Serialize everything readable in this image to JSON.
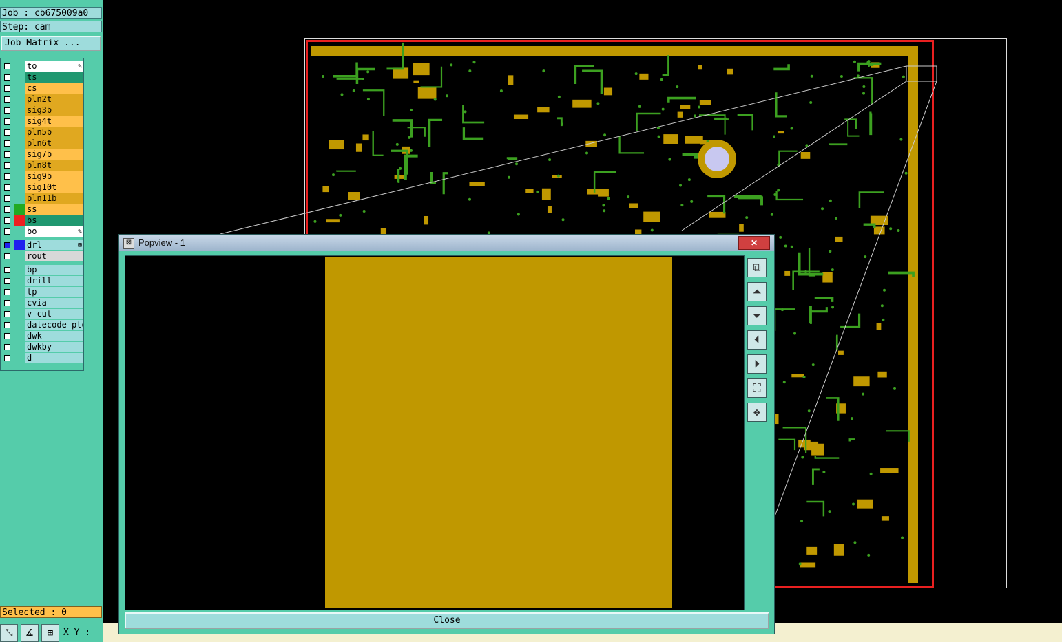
{
  "job_label": "Job : cb675009a0",
  "step_label": "Step: cam",
  "job_matrix_button": "Job Matrix ...",
  "layers_board": [
    {
      "name": "to",
      "color": "#ffffff",
      "checkbox": "#ffffff",
      "mark": "✎"
    },
    {
      "name": "ts",
      "color": "#209870",
      "checkbox": "#ffffff"
    },
    {
      "name": "cs",
      "color": "#ffc04a",
      "checkbox": "#ffffff"
    },
    {
      "name": "pln2t",
      "color": "#e0a820",
      "checkbox": "#ffffff"
    },
    {
      "name": "sig3b",
      "color": "#e0a820",
      "checkbox": "#ffffff"
    },
    {
      "name": "sig4t",
      "color": "#ffc04a",
      "checkbox": "#ffffff"
    },
    {
      "name": "pln5b",
      "color": "#e0a820",
      "checkbox": "#ffffff"
    },
    {
      "name": "pln6t",
      "color": "#e0a820",
      "checkbox": "#ffffff"
    },
    {
      "name": "sig7b",
      "color": "#ffc04a",
      "checkbox": "#ffffff"
    },
    {
      "name": "pln8t",
      "color": "#e0a820",
      "checkbox": "#ffffff"
    },
    {
      "name": "sig9b",
      "color": "#ffc04a",
      "checkbox": "#ffffff"
    },
    {
      "name": "sig10t",
      "color": "#ffc04a",
      "checkbox": "#ffffff"
    },
    {
      "name": "pln11b",
      "color": "#e0a820",
      "checkbox": "#ffffff"
    },
    {
      "name": "ss",
      "color": "#ffc04a",
      "checkbox": "#ffffff",
      "indicator": "#22aa22"
    },
    {
      "name": "bs",
      "color": "#209870",
      "checkbox": "#ffffff",
      "indicator": "#ee2020"
    },
    {
      "name": "bo",
      "color": "#ffffff",
      "checkbox": "#ffffff",
      "mark": "✎"
    }
  ],
  "layers_drill": [
    {
      "name": "drl",
      "color": "#9edcdc",
      "checkbox": "#2020ee",
      "indicator": "#2020ee",
      "mark": "⊞"
    },
    {
      "name": "rout",
      "color": "#d8d8d8",
      "checkbox": "#ffffff"
    }
  ],
  "layers_misc": [
    {
      "name": "bp",
      "color": "#9edcdc",
      "checkbox": "#ffffff"
    },
    {
      "name": "drill",
      "color": "#9edcdc",
      "checkbox": "#ffffff"
    },
    {
      "name": "tp",
      "color": "#9edcdc",
      "checkbox": "#ffffff"
    },
    {
      "name": "cvia",
      "color": "#9edcdc",
      "checkbox": "#ffffff"
    },
    {
      "name": "v-cut",
      "color": "#9edcdc",
      "checkbox": "#ffffff"
    },
    {
      "name": "datecode-pto",
      "color": "#9edcdc",
      "checkbox": "#ffffff"
    },
    {
      "name": "dwk",
      "color": "#9edcdc",
      "checkbox": "#ffffff"
    },
    {
      "name": "dwkby",
      "color": "#9edcdc",
      "checkbox": "#ffffff"
    },
    {
      "name": "d",
      "color": "#9edcdc",
      "checkbox": "#ffffff"
    }
  ],
  "selected_label": "Selected : 0",
  "xy_label": "X Y :",
  "popup": {
    "title": "Popview - 1",
    "close_x": "✕",
    "close_button": "Close"
  },
  "icons": {
    "popup": "popview-window-icon",
    "tools": [
      "zoom-home-icon",
      "pan-up-icon",
      "pan-down-icon",
      "pan-left-icon",
      "pan-right-icon",
      "zoom-fit-icon",
      "center-icon"
    ]
  },
  "colors": {
    "panel": "#55ccaa",
    "copper": "#c09800",
    "trace": "#3ca020",
    "board_outline": "#e82020"
  }
}
